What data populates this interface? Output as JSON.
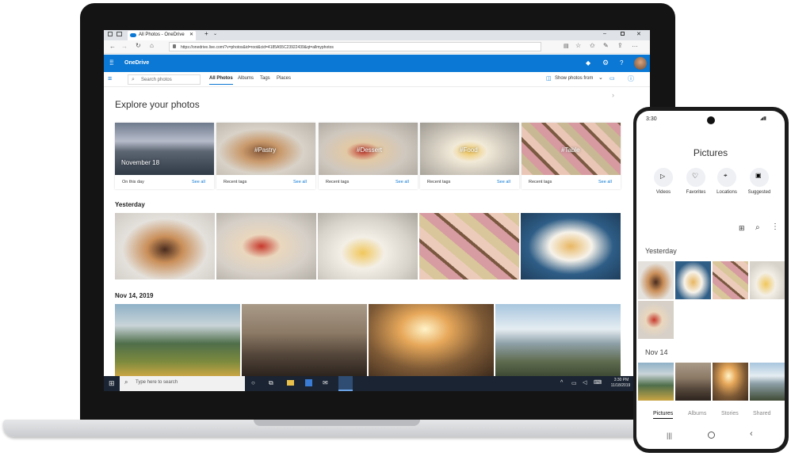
{
  "browser": {
    "tab_title": "All Photos - OneDrive",
    "url": "https://onedrive.live.com/?v=photos&id=root&cid=4185A55C23922439&qt=allmyphotos"
  },
  "onedrive": {
    "app_name": "OneDrive",
    "search_placeholder": "Search photos",
    "pivots": [
      "All Photos",
      "Albums",
      "Tags",
      "Places"
    ],
    "show_photos_from": "Show photos from",
    "explore_title": "Explore your photos",
    "cards": [
      {
        "overlay": "November 18",
        "label": "On this day",
        "link": "See all"
      },
      {
        "overlay": "#Pastry",
        "label": "Recent tags",
        "link": "See all"
      },
      {
        "overlay": "#Dessert",
        "label": "Recent tags",
        "link": "See all"
      },
      {
        "overlay": "#Food",
        "label": "Recent tags",
        "link": "See all"
      },
      {
        "overlay": "#Table",
        "label": "Recent tags",
        "link": "See all"
      }
    ],
    "section_yesterday": "Yesterday",
    "section_nov": "Nov 14, 2019"
  },
  "taskbar": {
    "search_text": "Type here to search",
    "time": "3:30 PM",
    "date": "11/18/2019"
  },
  "phone": {
    "time": "3:30",
    "title": "Pictures",
    "quick_actions": [
      "Videos",
      "Favorites",
      "Locations",
      "Suggested"
    ],
    "section_yesterday": "Yesterday",
    "section_nov": "Nov 14",
    "tabs": [
      "Pictures",
      "Albums",
      "Stories",
      "Shared"
    ]
  },
  "colors": {
    "accent": "#0a78d4",
    "taskbar": "#1a2433"
  }
}
